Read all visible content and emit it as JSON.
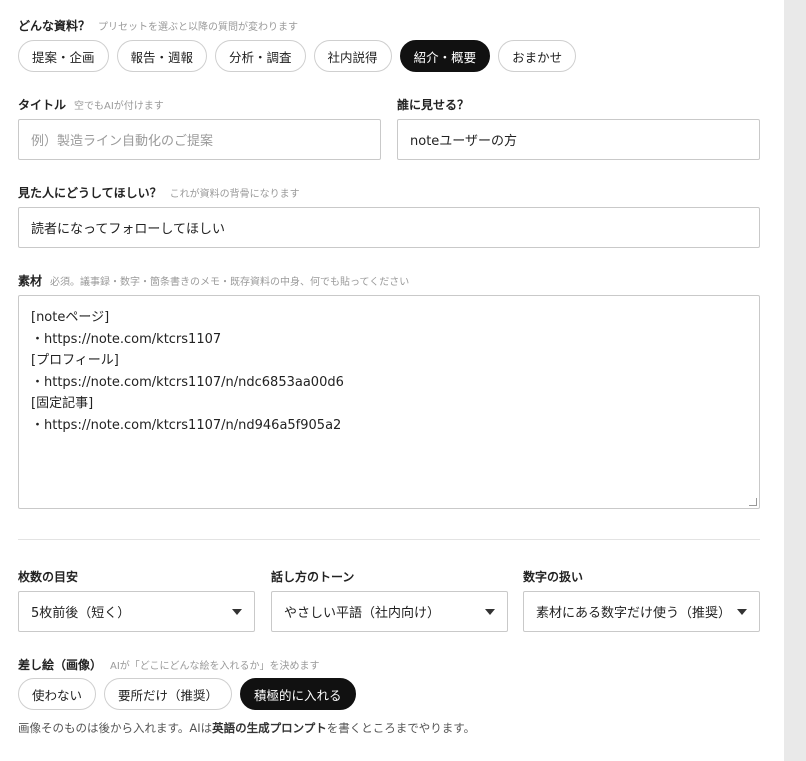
{
  "doc_type": {
    "label": "どんな資料？",
    "hint": "プリセットを選ぶと以降の質問が変わります",
    "options": [
      "提案・企画",
      "報告・週報",
      "分析・調査",
      "社内説得",
      "紹介・概要",
      "おまかせ"
    ],
    "selected": "紹介・概要"
  },
  "title_field": {
    "label": "タイトル",
    "hint": "空でもAIが付けます",
    "value": "",
    "placeholder": "例）製造ライン自動化のご提案"
  },
  "audience_field": {
    "label": "誰に見せる？",
    "value": "noteユーザーの方"
  },
  "goal_field": {
    "label": "見た人にどうしてほしい？",
    "hint": "これが資料の背骨になります",
    "value": "読者になってフォローしてほしい"
  },
  "material_field": {
    "label": "素材",
    "hint": "必須。議事録・数字・箇条書きのメモ・既存資料の中身、何でも貼ってください",
    "lines": [
      "[noteページ]",
      "・https://note.com/ktcrs1107",
      "[プロフィール]",
      "・https://note.com/ktcrs1107/n/ndc6853aa00d6",
      "[固定記事]",
      "・https://note.com/ktcrs1107/n/nd946a5f905a2"
    ]
  },
  "slide_count": {
    "label": "枚数の目安",
    "value": "5枚前後（短く）"
  },
  "tone": {
    "label": "話し方のトーン",
    "value": "やさしい平語（社内向け）"
  },
  "numbers": {
    "label": "数字の扱い",
    "value": "素材にある数字だけ使う（推奨）"
  },
  "illustration": {
    "label": "差し絵（画像）",
    "hint": "AIが「どこにどんな絵を入れるか」を決めます",
    "options": [
      "使わない",
      "要所だけ（推奨）",
      "積極的に入れる"
    ],
    "selected": "積極的に入れる",
    "note_part1": "画像そのものは後から入れます。AIは",
    "note_bold": "英語の生成プロンプト",
    "note_part2": "を書くところまでやります。"
  }
}
